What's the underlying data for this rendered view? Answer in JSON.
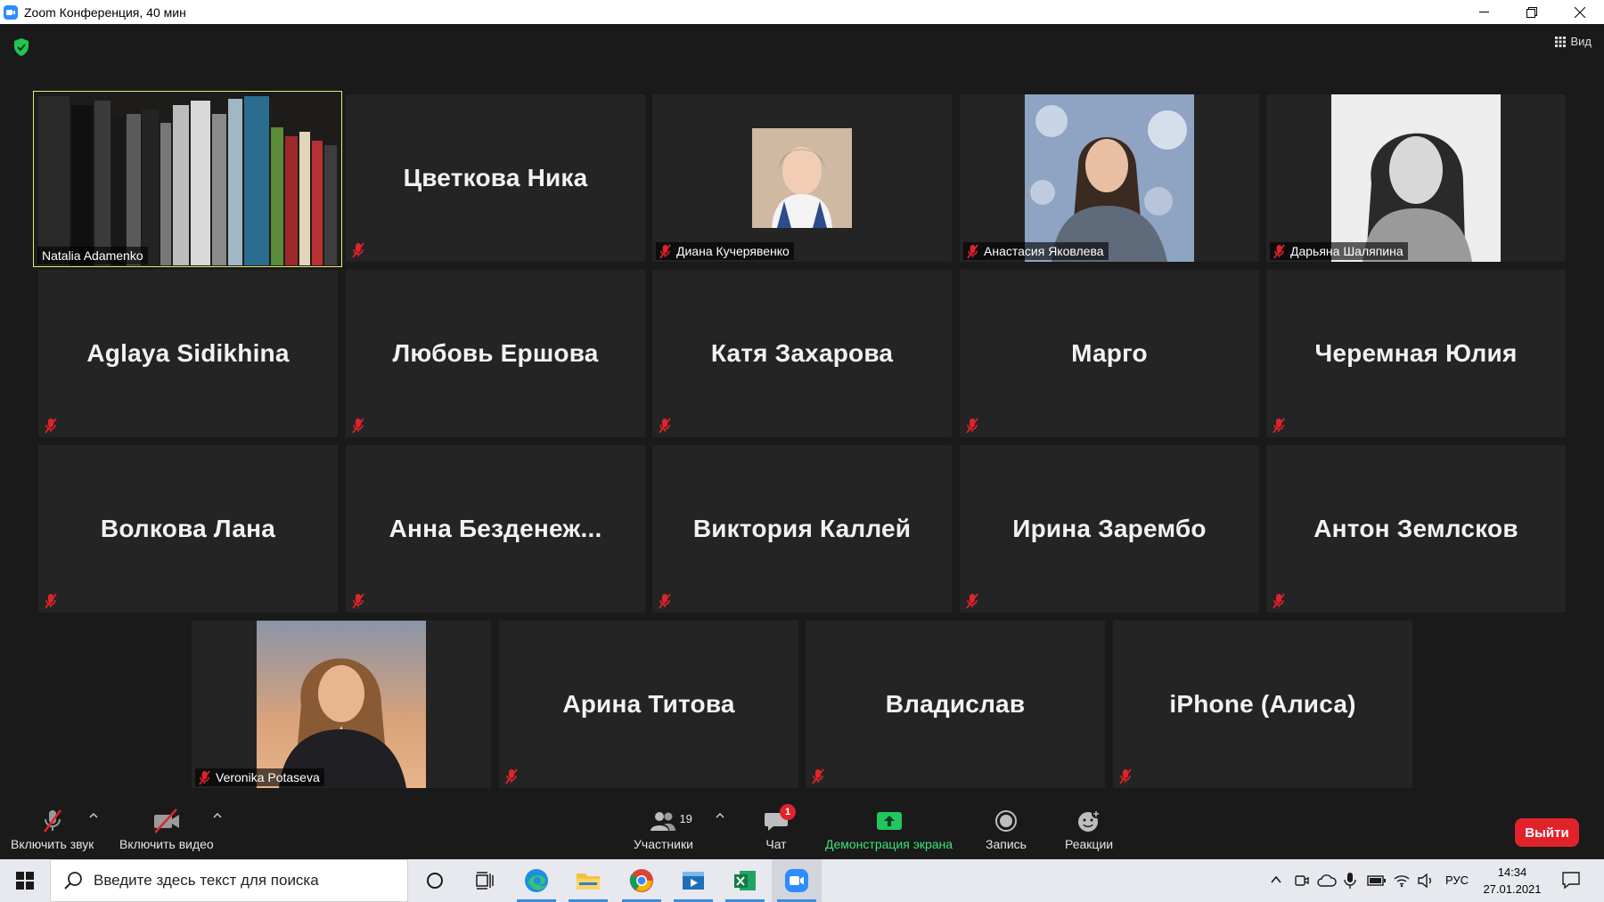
{
  "window": {
    "title": "Zoom Конференция, 40 мин"
  },
  "topbar": {
    "view_label": "Вид"
  },
  "gallery": {
    "tiles": [
      {
        "name": "Natalia Adamenko",
        "type": "video",
        "muted": false,
        "active": true
      },
      {
        "name": "Цветкова Ника",
        "type": "name",
        "muted": true
      },
      {
        "name": "Диана Кучерявенко",
        "type": "photo",
        "muted": true
      },
      {
        "name": "Анастасия Яковлева",
        "type": "photo",
        "muted": true
      },
      {
        "name": "Дарьяна Шаляпина",
        "type": "photo",
        "muted": true
      },
      {
        "name": "Aglaya Sidikhina",
        "type": "name",
        "muted": true
      },
      {
        "name": "Любовь Ершова",
        "type": "name",
        "muted": true
      },
      {
        "name": "Катя Захарова",
        "type": "name",
        "muted": true
      },
      {
        "name": "Марго",
        "type": "name",
        "muted": true
      },
      {
        "name": "Черемная Юлия",
        "type": "name",
        "muted": true
      },
      {
        "name": "Волкова Лана",
        "type": "name",
        "muted": true
      },
      {
        "name": "Анна  Безденеж...",
        "type": "name",
        "muted": true
      },
      {
        "name": "Виктория Каллей",
        "type": "name",
        "muted": true
      },
      {
        "name": "Ирина Зарембо",
        "type": "name",
        "muted": true
      },
      {
        "name": "Антон Землсков",
        "type": "name",
        "muted": true
      },
      {
        "name": "Veronika Potaseva",
        "type": "photo",
        "muted": true
      },
      {
        "name": "Арина Титова",
        "type": "name",
        "muted": true
      },
      {
        "name": "Владислав",
        "type": "name",
        "muted": true
      },
      {
        "name": "iPhone (Алиса)",
        "type": "name",
        "muted": true
      }
    ]
  },
  "controls": {
    "unmute_label": "Включить звук",
    "start_video_label": "Включить видео",
    "participants_label": "Участники",
    "participants_count": "19",
    "chat_label": "Чат",
    "chat_badge": "1",
    "share_label": "Демонстрация экрана",
    "record_label": "Запись",
    "reactions_label": "Реакции",
    "leave_label": "Выйти"
  },
  "taskbar": {
    "search_placeholder": "Введите здесь текст для поиска",
    "language": "РУС",
    "time": "14:34",
    "date": "27.01.2021"
  },
  "colors": {
    "background": "#1a1a1a",
    "tile": "#242424",
    "active_speaker": "#e5ed76",
    "muted_icon": "#e0232b",
    "share_green": "#22c55e",
    "leave_red": "#e0232b"
  }
}
